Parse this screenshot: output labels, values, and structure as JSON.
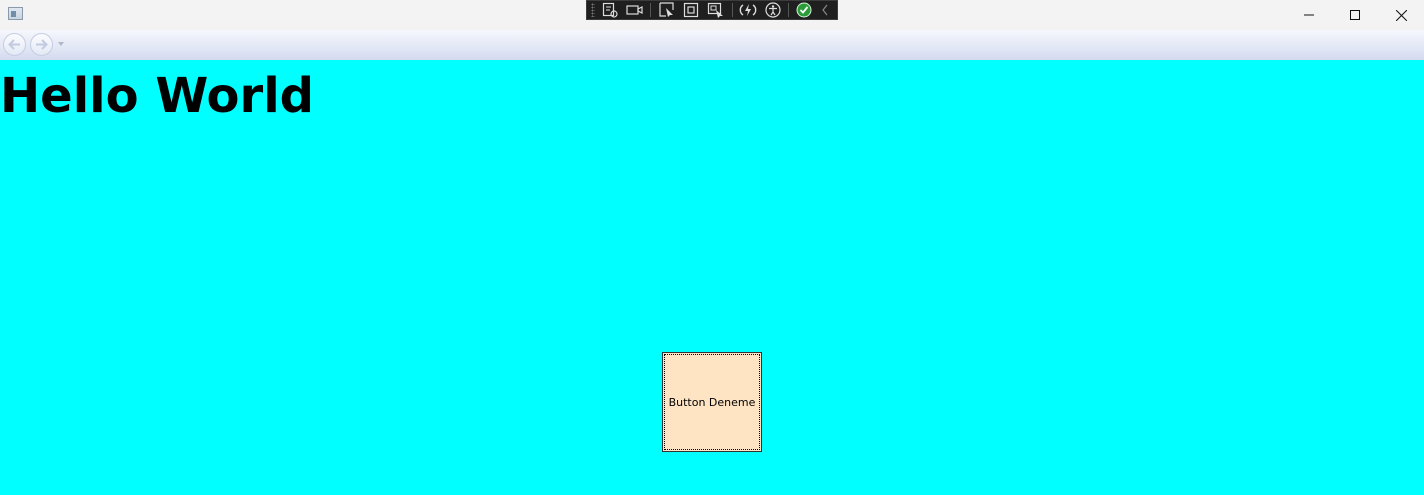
{
  "window": {
    "controls": {
      "minimize_icon": "minimize-icon",
      "maximize_icon": "maximize-icon",
      "close_icon": "close-icon"
    }
  },
  "debug_toolbar": {
    "icons": [
      "live-visual-tree-icon",
      "record-icon",
      "select-element-icon",
      "display-layout-adorners-icon",
      "track-focus-icon",
      "hot-reload-icon",
      "accessibility-icon",
      "check-icon",
      "collapse-chevron-icon"
    ]
  },
  "navigation": {
    "back_icon": "back-arrow-icon",
    "forward_icon": "forward-arrow-icon"
  },
  "content": {
    "heading": "Hello World",
    "button_label": "Button Deneme",
    "background_color": "#00ffff",
    "button_color": "#ffe4c4"
  }
}
